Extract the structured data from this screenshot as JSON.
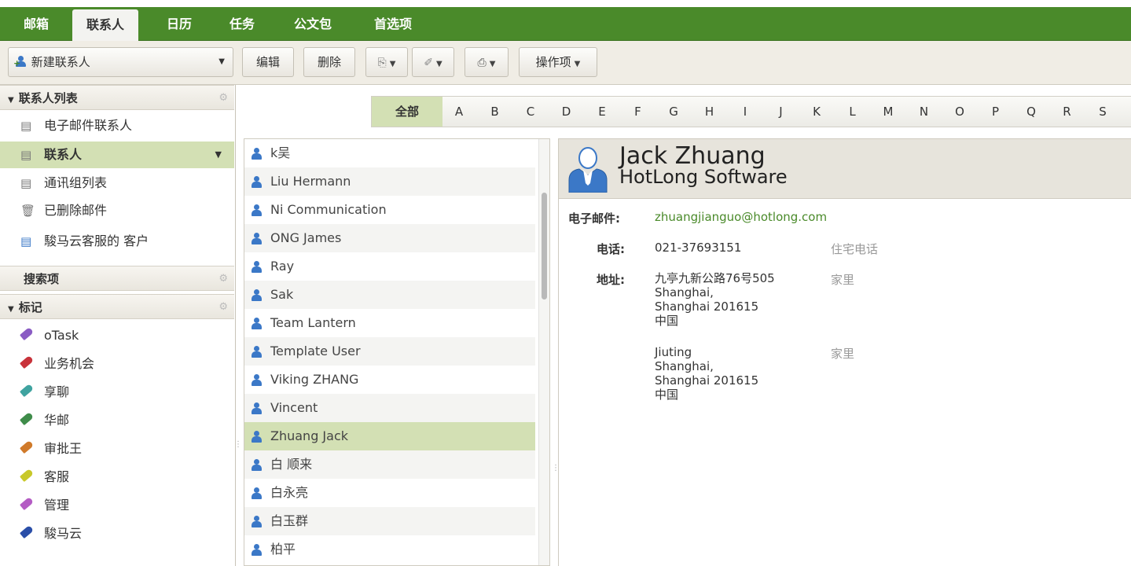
{
  "top_tabs": [
    {
      "label": "邮箱"
    },
    {
      "label": "联系人",
      "active": true
    },
    {
      "label": "日历"
    },
    {
      "label": "任务"
    },
    {
      "label": "公文包"
    },
    {
      "label": "首选项"
    }
  ],
  "toolbar": {
    "new_contact": "新建联系人",
    "edit": "编辑",
    "delete": "删除",
    "actions": "操作项"
  },
  "sidebar": {
    "contact_list_header": "联系人列表",
    "address_books": [
      {
        "label": "电子邮件联系人",
        "icon": "addressbook-icon"
      },
      {
        "label": "联系人",
        "icon": "addressbook-icon",
        "selected": true
      },
      {
        "label": "通讯组列表",
        "icon": "addressbook-icon"
      },
      {
        "label": "已删除邮件",
        "icon": "trash-icon"
      },
      {
        "label": "駿马云客服的 客户",
        "icon": "shared-addressbook-icon"
      }
    ],
    "searches_header": "搜索项",
    "tags_header": "标记",
    "tags": [
      {
        "label": "oTask",
        "color": "#8a5cc4"
      },
      {
        "label": "业务机会",
        "color": "#c8323a"
      },
      {
        "label": "享聊",
        "color": "#3fa3a0"
      },
      {
        "label": "华邮",
        "color": "#3f8c4a"
      },
      {
        "label": "审批王",
        "color": "#d07a2a"
      },
      {
        "label": "客服",
        "color": "#c8c82a"
      },
      {
        "label": "管理",
        "color": "#b45cc4"
      },
      {
        "label": "駿马云",
        "color": "#2a4ea8"
      }
    ]
  },
  "alphabet": {
    "all": "全部",
    "letters": [
      "A",
      "B",
      "C",
      "D",
      "E",
      "F",
      "G",
      "H",
      "I",
      "J",
      "K",
      "L",
      "M",
      "N",
      "O",
      "P",
      "Q",
      "R",
      "S"
    ]
  },
  "contacts": [
    "k吴",
    "Liu Hermann",
    "Ni Communication",
    "ONG James",
    "Ray",
    "Sak",
    "Team Lantern",
    "Template User",
    "Viking ZHANG",
    "Vincent",
    "Zhuang Jack",
    "白 顺来",
    "白永亮",
    "白玉群",
    "柏平"
  ],
  "selected_contact_index": 10,
  "detail": {
    "name": "Jack Zhuang",
    "company": "HotLong Software",
    "email_label": "电子邮件:",
    "email": "zhuangjianguo@hotlong.com",
    "phone_label": "电话:",
    "phone": "021-37693151",
    "phone_type": "住宅电话",
    "address_label": "地址:",
    "addresses": [
      {
        "lines": [
          "九亭九新公路76号505",
          "Shanghai,",
          "Shanghai 201615",
          "中国"
        ],
        "type": "家里"
      },
      {
        "lines": [
          "Jiuting",
          "Shanghai,",
          "Shanghai 201615",
          "中国"
        ],
        "type": "家里"
      }
    ]
  },
  "colors": {
    "brand_green": "#4a8a2a",
    "selection": "#d3e0b4",
    "person_icon": "#3b78c7"
  }
}
